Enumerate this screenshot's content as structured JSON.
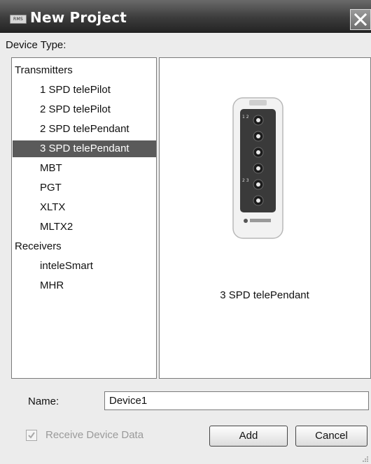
{
  "window": {
    "title": "New Project",
    "logo_text": "RMS"
  },
  "device_type_label": "Device Type:",
  "device_list": {
    "groups": [
      {
        "label": "Transmitters",
        "items": [
          {
            "label": "1 SPD telePilot",
            "selected": false
          },
          {
            "label": "2 SPD telePilot",
            "selected": false
          },
          {
            "label": "2 SPD telePendant",
            "selected": false
          },
          {
            "label": "3 SPD telePendant",
            "selected": true
          },
          {
            "label": "MBT",
            "selected": false
          },
          {
            "label": "PGT",
            "selected": false
          },
          {
            "label": "XLTX",
            "selected": false
          },
          {
            "label": "MLTX2",
            "selected": false
          }
        ]
      },
      {
        "label": "Receivers",
        "items": [
          {
            "label": "inteleSmart",
            "selected": false
          },
          {
            "label": "MHR",
            "selected": false
          }
        ]
      }
    ],
    "selected_color": "#5a5a5a"
  },
  "preview": {
    "caption": "3 SPD telePendant",
    "image_icon": "pendant-remote-image"
  },
  "name_field": {
    "label": "Name:",
    "value": "Device1"
  },
  "receive_data": {
    "label": "Receive Device Data",
    "checked": true,
    "enabled": false
  },
  "buttons": {
    "add": "Add",
    "cancel": "Cancel"
  },
  "colors": {
    "titlebar": "#3c3c3c",
    "dialog_bg": "#ececec",
    "selection": "#5a5a5a"
  }
}
